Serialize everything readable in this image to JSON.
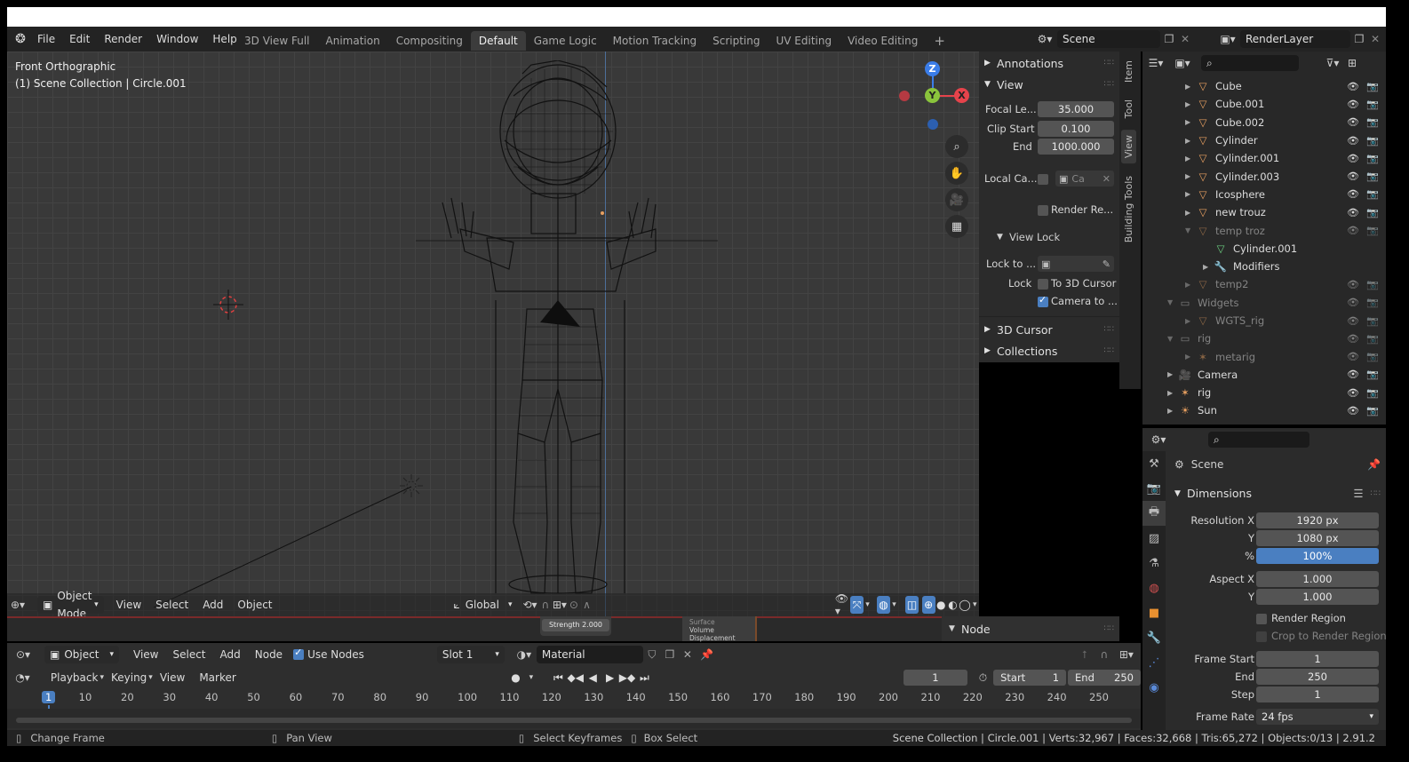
{
  "colors": {
    "accent": "#4a7fc1",
    "object_orange": "#e8a060",
    "data_green": "#6ccf80",
    "axis_x": "#e5434b",
    "axis_y": "#8ac43c",
    "axis_z": "#3b7de8"
  },
  "topbar": {
    "menu": [
      "File",
      "Edit",
      "Render",
      "Window",
      "Help"
    ],
    "tabs": [
      "3D View Full",
      "Animation",
      "Compositing",
      "Default",
      "Game Logic",
      "Motion Tracking",
      "Scripting",
      "UV Editing",
      "Video Editing"
    ],
    "active_tab": "Default",
    "add_tab": "+",
    "scene": "Scene",
    "render_layer": "RenderLayer"
  },
  "viewport": {
    "view_name": "Front Orthographic",
    "collection_info": "(1) Scene Collection | Circle.001",
    "gizmo": {
      "x": "X",
      "y": "Y",
      "z": "Z"
    },
    "header": {
      "mode": "Object Mode",
      "menu": [
        "View",
        "Select",
        "Add",
        "Object"
      ],
      "orientation": "Global"
    },
    "node_strength": "Strength  2.000",
    "node_sockets": [
      "Surface",
      "Volume",
      "Displacement"
    ]
  },
  "sidebar_tabs": [
    "Item",
    "Tool",
    "View",
    "Building Tools"
  ],
  "npanel": {
    "annotations": "Annotations",
    "view": "View",
    "focal_label": "Focal Le...",
    "focal_value": "35.000",
    "clip_start_label": "Clip Start",
    "clip_start_value": "0.100",
    "clip_end_label": "End",
    "clip_end_value": "1000.000",
    "local_camera_label": "Local Ca...",
    "local_camera_value": "Ca",
    "render_region_label": "Render Re...",
    "view_lock": "View Lock",
    "lock_to_label": "Lock to ...",
    "lock_label": "Lock",
    "to_3d_cursor": "To 3D Cursor",
    "camera_to": "Camera to ...",
    "cursor_3d": "3D Cursor",
    "collections": "Collections"
  },
  "outliner": {
    "items": [
      {
        "name": "Cube",
        "indent": 2,
        "type": "mesh",
        "dim": false
      },
      {
        "name": "Cube.001",
        "indent": 2,
        "type": "mesh",
        "dim": false
      },
      {
        "name": "Cube.002",
        "indent": 2,
        "type": "mesh",
        "dim": false
      },
      {
        "name": "Cylinder",
        "indent": 2,
        "type": "mesh",
        "dim": false
      },
      {
        "name": "Cylinder.001",
        "indent": 2,
        "type": "mesh",
        "dim": false
      },
      {
        "name": "Cylinder.003",
        "indent": 2,
        "type": "mesh",
        "dim": false
      },
      {
        "name": "Icosphere",
        "indent": 2,
        "type": "mesh",
        "dim": false
      },
      {
        "name": "new trouz",
        "indent": 2,
        "type": "mesh",
        "dim": false
      },
      {
        "name": "temp troz",
        "indent": 2,
        "type": "mesh",
        "dim": true
      },
      {
        "name": "Cylinder.001",
        "indent": 3,
        "type": "data",
        "dim": false
      },
      {
        "name": "Modifiers",
        "indent": 3,
        "type": "modifier",
        "dim": false
      },
      {
        "name": "temp2",
        "indent": 2,
        "type": "mesh",
        "dim": true
      },
      {
        "name": "Widgets",
        "indent": 1,
        "type": "collection",
        "dim": true
      },
      {
        "name": "WGTS_rig",
        "indent": 2,
        "type": "mesh",
        "dim": true
      },
      {
        "name": "rig",
        "indent": 1,
        "type": "collection",
        "dim": true
      },
      {
        "name": "metarig",
        "indent": 2,
        "type": "armature",
        "dim": true
      },
      {
        "name": "Camera",
        "indent": 1,
        "type": "camera",
        "dim": false
      },
      {
        "name": "rig",
        "indent": 1,
        "type": "armature",
        "dim": false
      },
      {
        "name": "Sun",
        "indent": 1,
        "type": "light",
        "dim": false
      }
    ]
  },
  "properties": {
    "context": "Scene",
    "section": "Dimensions",
    "res_x_label": "Resolution X",
    "res_x": "1920 px",
    "res_y_label": "Y",
    "res_y": "1080 px",
    "res_pct_label": "%",
    "res_pct": "100%",
    "aspect_x_label": "Aspect X",
    "aspect_x": "1.000",
    "aspect_y_label": "Y",
    "aspect_y": "1.000",
    "render_region": "Render Region",
    "crop_region": "Crop to Render Region",
    "frame_start_label": "Frame Start",
    "frame_start": "1",
    "frame_end_label": "End",
    "frame_end": "250",
    "frame_step_label": "Step",
    "frame_step": "1",
    "frame_rate_label": "Frame Rate",
    "frame_rate": "24 fps"
  },
  "node_editor": {
    "object": "Object",
    "menu": [
      "View",
      "Select",
      "Add",
      "Node"
    ],
    "use_nodes": "Use Nodes",
    "slot": "Slot 1",
    "material": "Material",
    "node_panel": "Node"
  },
  "timeline": {
    "menu": [
      "Playback",
      "Keying",
      "View",
      "Marker"
    ],
    "current_frame": "1",
    "start_label": "Start",
    "start": "1",
    "end_label": "End",
    "end": "250",
    "ticks": [
      "1",
      "10",
      "20",
      "30",
      "40",
      "50",
      "60",
      "70",
      "80",
      "90",
      "100",
      "110",
      "120",
      "130",
      "140",
      "150",
      "160",
      "170",
      "180",
      "190",
      "200",
      "210",
      "220",
      "230",
      "240",
      "250"
    ]
  },
  "status": {
    "change_frame": "Change Frame",
    "pan_view": "Pan View",
    "select_keyframes": "Select Keyframes",
    "box_select": "Box Select",
    "info": "Scene Collection | Circle.001 | Verts:32,967 | Faces:32,668 | Tris:65,272 | Objects:0/13 | 2.91.2"
  }
}
